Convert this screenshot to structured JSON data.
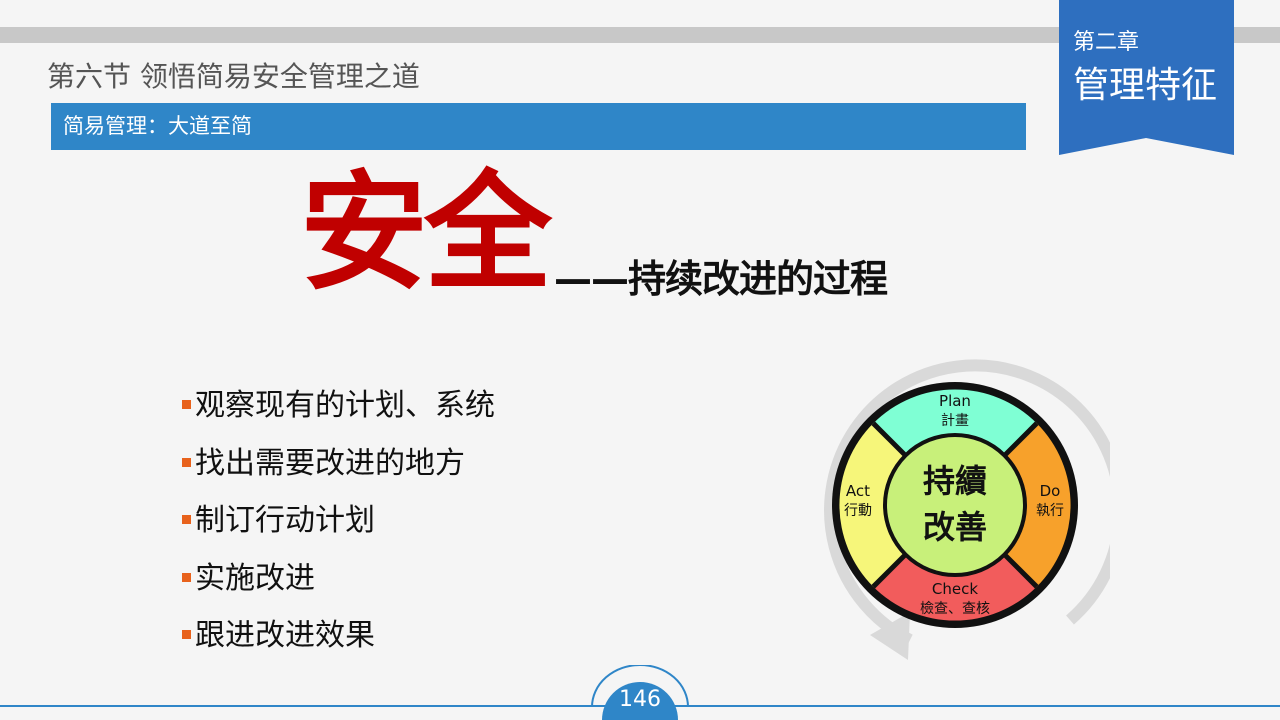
{
  "header": {
    "section_title": "第六节  领悟简易安全管理之道",
    "subtitle": "简易管理：大道至简"
  },
  "chapter": {
    "label": "第二章",
    "title": "管理特征"
  },
  "headline": {
    "main": "安全",
    "sub": "——持续改进的过程"
  },
  "bullets": [
    "观察现有的计划、系统",
    "找出需要改进的地方",
    "制订行动计划",
    "实施改进",
    "跟进改进效果"
  ],
  "cycle": {
    "center_line1": "持續",
    "center_line2": "改善",
    "plan": {
      "en": "Plan",
      "zh": "計畫"
    },
    "do": {
      "en": "Do",
      "zh": "執行"
    },
    "check": {
      "en": "Check",
      "zh": "檢查、查核"
    },
    "act": {
      "en": "Act",
      "zh": "行動"
    }
  },
  "footer": {
    "page_number": "146"
  },
  "colors": {
    "accent_blue": "#2f86c8",
    "flag_blue": "#2e6fbf",
    "headline_red": "#c00000",
    "bullet_orange": "#e8621c",
    "plan_color": "#7fffd4",
    "do_color": "#f7a12b",
    "check_color": "#f25c5c",
    "act_color": "#f6f67a",
    "center_color": "#c8f07a"
  }
}
